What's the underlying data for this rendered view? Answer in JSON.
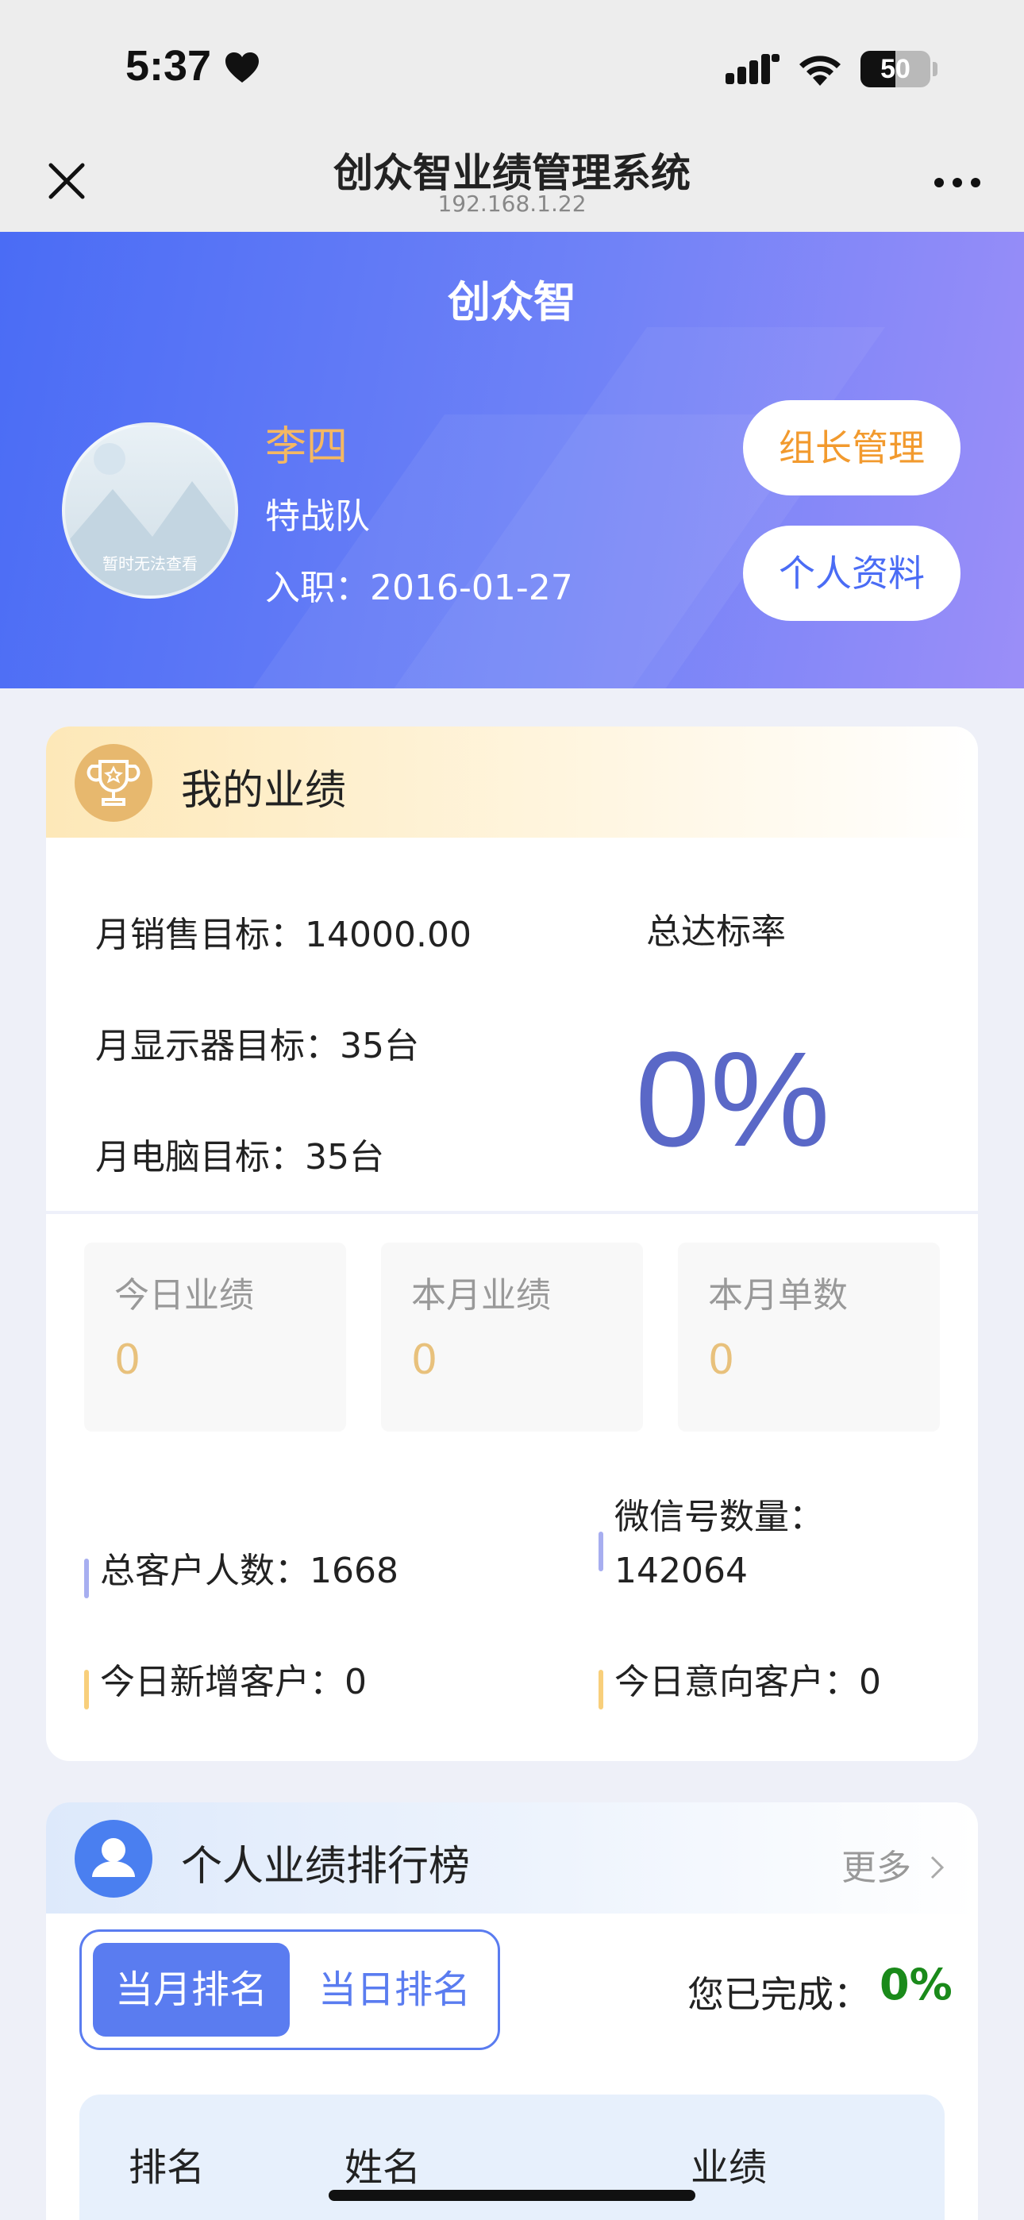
{
  "status_bar": {
    "time": "5:37",
    "battery": "50",
    "battery_level": 0.5
  },
  "nav": {
    "title": "创众智业绩管理系统",
    "subtitle": "192.168.1.22"
  },
  "banner": {
    "title": "创众智",
    "avatar_text": "暂时无法查看",
    "user_name": "李四",
    "team": "特战队",
    "join_date": "入职：2016-01-27",
    "leader_button": "组长管理",
    "profile_button": "个人资料"
  },
  "performance": {
    "title": "我的业绩",
    "monthly_sales_target": "月销售目标：14000.00",
    "monthly_monitor_target": "月显示器目标：35台",
    "monthly_computer_target": "月电脑目标：35台",
    "rate_label": "总达标率",
    "rate_value": "0%",
    "stats": [
      {
        "label": "今日业绩",
        "value": "0"
      },
      {
        "label": "本月业绩",
        "value": "0"
      },
      {
        "label": "本月单数",
        "value": "0"
      }
    ],
    "total_customers": "总客户人数：1668",
    "wechat_label": "微信号数量：",
    "wechat_value": "142064",
    "today_new": "今日新增客户：0",
    "today_intent": "今日意向客户：0"
  },
  "ranking": {
    "title": "个人业绩排行榜",
    "more": "更多",
    "tab_month": "当月排名",
    "tab_day": "当日排名",
    "done_label": "您已完成：",
    "done_value": "0%",
    "columns": [
      "排名",
      "姓名",
      "业绩"
    ]
  }
}
